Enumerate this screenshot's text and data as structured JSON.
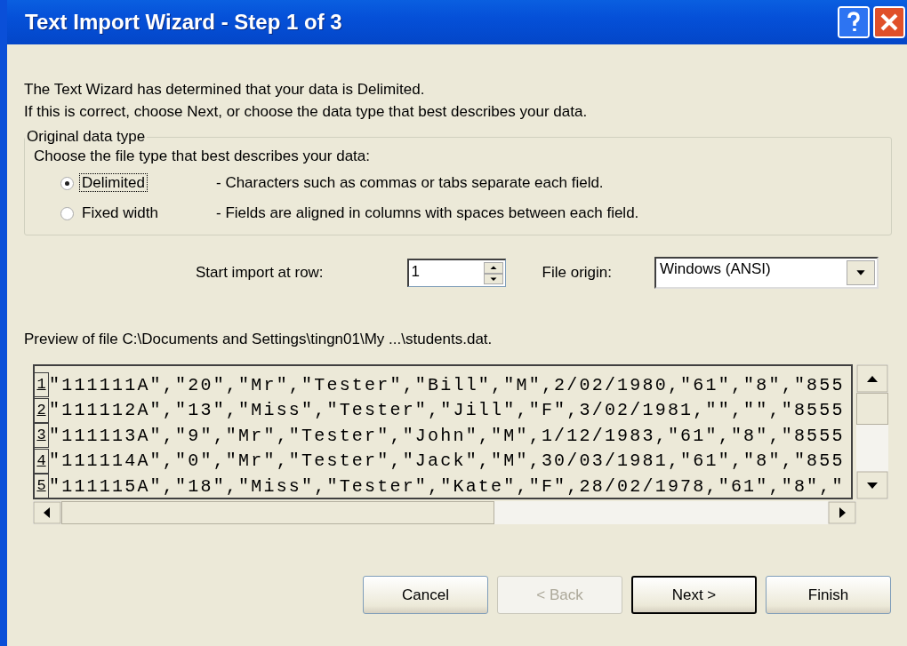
{
  "window": {
    "title": "Text Import Wizard - Step 1 of 3"
  },
  "intro": [
    "The Text Wizard has determined that your data is Delimited.",
    "If this is correct, choose Next, or choose the data type that best describes your data."
  ],
  "group": {
    "title": "Original data type",
    "prompt": "Choose the file type that best describes your data:",
    "options": [
      {
        "label": "Delimited",
        "description": "- Characters such as commas or tabs separate each field.",
        "selected": true
      },
      {
        "label": "Fixed width",
        "description": "- Fields are aligned in columns with spaces between each field.",
        "selected": false
      }
    ]
  },
  "start_row": {
    "label": "Start import at row:",
    "value": "1"
  },
  "file_origin": {
    "label": "File origin:",
    "value": "Windows (ANSI)"
  },
  "preview": {
    "label": "Preview of file C:\\Documents and Settings\\tingn01\\My ...\\students.dat.",
    "rows": [
      {
        "number": "1",
        "text": "\"111111A\",\"20\",\"Mr\",\"Tester\",\"Bill\",\"M\",2/02/1980,\"61\",\"8\",\"855"
      },
      {
        "number": "2",
        "text": "\"111112A\",\"13\",\"Miss\",\"Tester\",\"Jill\",\"F\",3/02/1981,\"\",\"\",\"8555"
      },
      {
        "number": "3",
        "text": "\"111113A\",\"9\",\"Mr\",\"Tester\",\"John\",\"M\",1/12/1983,\"61\",\"8\",\"8555"
      },
      {
        "number": "4",
        "text": "\"111114A\",\"0\",\"Mr\",\"Tester\",\"Jack\",\"M\",30/03/1981,\"61\",\"8\",\"855"
      },
      {
        "number": "5",
        "text": "\"111115A\",\"18\",\"Miss\",\"Tester\",\"Kate\",\"F\",28/02/1978,\"61\",\"8\",\""
      }
    ]
  },
  "buttons": [
    {
      "label": "Cancel",
      "disabled": false,
      "default": false
    },
    {
      "label": "< Back",
      "disabled": true,
      "default": false
    },
    {
      "label": "Next >",
      "disabled": false,
      "default": true
    },
    {
      "label": "Finish",
      "disabled": false,
      "default": false
    }
  ]
}
